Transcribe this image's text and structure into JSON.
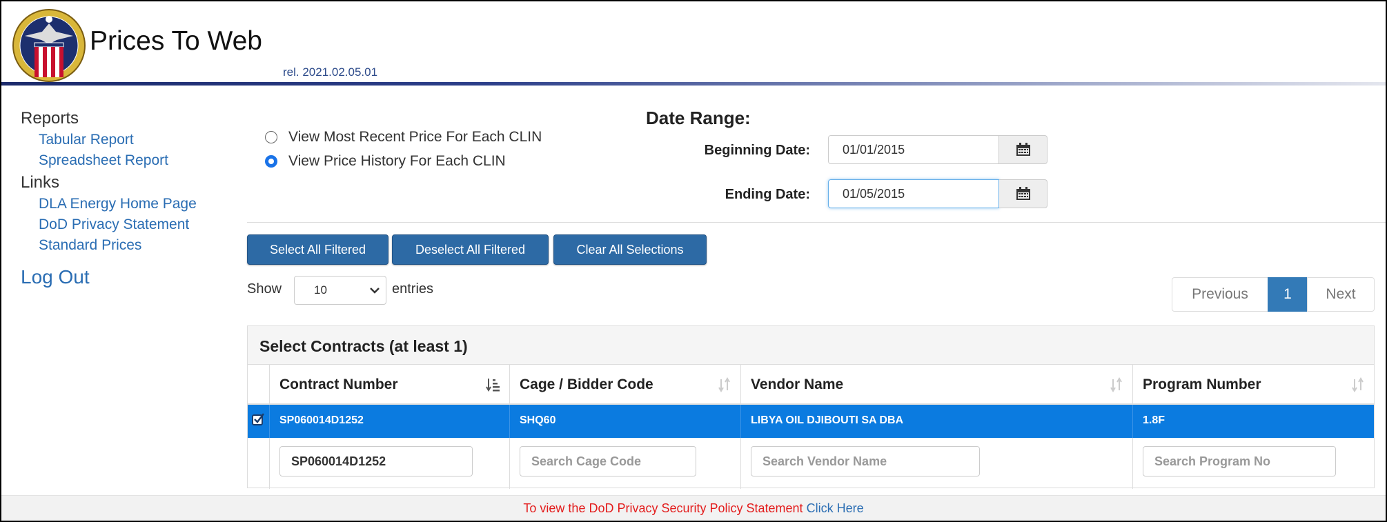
{
  "header": {
    "title": "Prices To Web",
    "release": "rel. 2021.02.05.01"
  },
  "sidebar": {
    "reports_heading": "Reports",
    "reports": [
      "Tabular Report",
      "Spreadsheet Report"
    ],
    "links_heading": "Links",
    "links": [
      "DLA Energy Home Page",
      "DoD Privacy Statement",
      "Standard Prices"
    ],
    "logout": "Log Out"
  },
  "view_options": [
    {
      "label": "View Most Recent Price For Each CLIN",
      "checked": false
    },
    {
      "label": "View Price History For Each CLIN",
      "checked": true
    }
  ],
  "date_range": {
    "title": "Date Range:",
    "begin_label": "Beginning Date:",
    "begin_value": "01/01/2015",
    "end_label": "Ending Date:",
    "end_value": "01/05/2015"
  },
  "actions": {
    "select_all": "Select All Filtered",
    "deselect_all": "Deselect All Filtered",
    "clear_all": "Clear All Selections"
  },
  "entries": {
    "show_label": "Show",
    "page_size": "10",
    "entries_label": "entries"
  },
  "pagination": {
    "previous": "Previous",
    "current": "1",
    "next": "Next"
  },
  "contracts_table": {
    "title": "Select Contracts (at least 1)",
    "columns": [
      "Contract Number",
      "Cage / Bidder Code",
      "Vendor Name",
      "Program Number"
    ],
    "rows": [
      {
        "selected": true,
        "contract": "SP060014D1252",
        "cage": "SHQ60",
        "vendor": "LIBYA OIL DJIBOUTI SA DBA",
        "program": "1.8F"
      }
    ],
    "filters": {
      "contract_value": "SP060014D1252",
      "cage_placeholder": "Search Cage Code",
      "vendor_placeholder": "Search Vendor Name",
      "program_placeholder": "Search Program No"
    }
  },
  "footer": {
    "text": "To view the DoD Privacy Security Policy Statement",
    "link": "Click Here"
  },
  "colors": {
    "primary_button": "#2d6aa5",
    "selected_row": "#0b7be0",
    "link": "#2a6db3",
    "footer_warning": "#e31b1b"
  },
  "icons": [
    "dla-seal-icon",
    "calendar-icon",
    "chevron-down-icon",
    "sort-amount-icon",
    "sort-icon",
    "checkbox-checked-icon"
  ]
}
